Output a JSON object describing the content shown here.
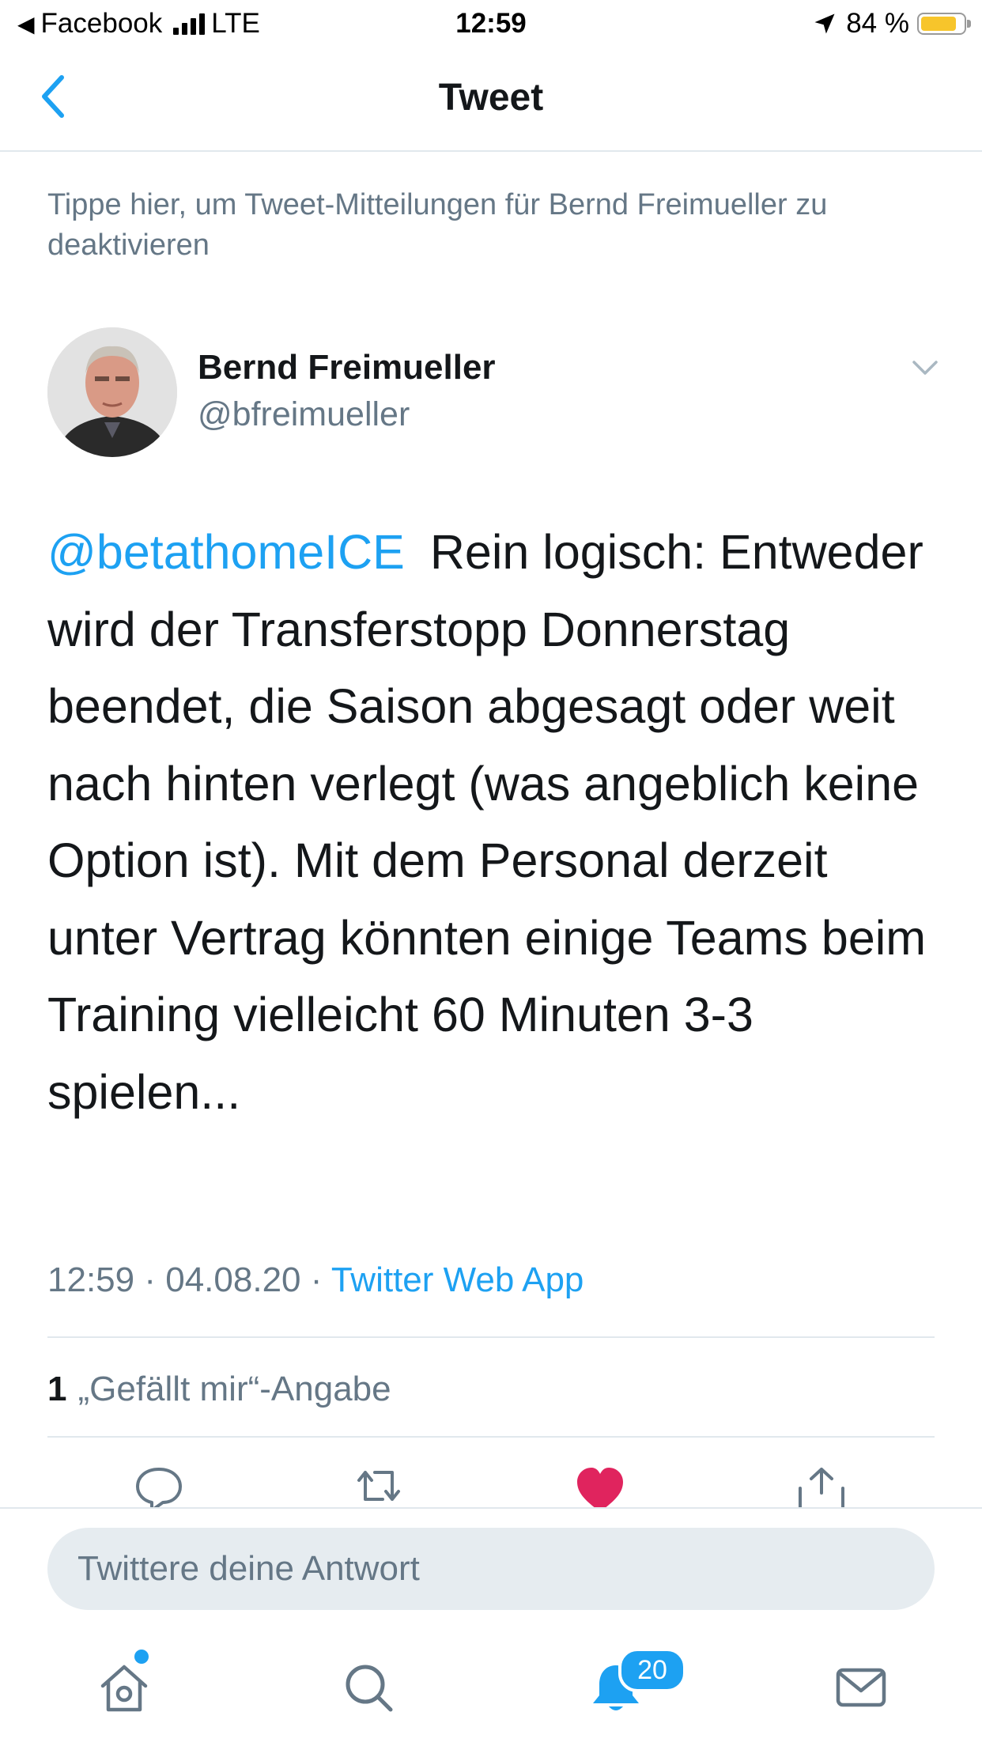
{
  "status_bar": {
    "back_app": "Facebook",
    "network": "LTE",
    "time": "12:59",
    "battery": "84 %",
    "battery_level": 0.84
  },
  "nav": {
    "title": "Tweet"
  },
  "notice": "Tippe hier, um Tweet-Mitteilungen für Bernd Freimueller zu deaktivieren",
  "author": {
    "name": "Bernd Freimueller",
    "handle": "@bfreimueller"
  },
  "tweet": {
    "mention": "@betathomeICE",
    "body": "Rein logisch: Entweder wird der Transferstopp Donnerstag beendet, die Saison abgesagt oder weit nach hinten verlegt (was angeblich keine Option ist). Mit dem Personal derzeit unter Vertrag könnten einige Teams beim Training vielleicht 60 Minuten 3-3 spielen..."
  },
  "meta": {
    "time": "12:59",
    "separator": "·",
    "date": "04.08.20",
    "via": "Twitter Web App"
  },
  "likes": {
    "count": "1",
    "label": "„Gefällt mir“-Angabe"
  },
  "reply": {
    "placeholder": "Twittere deine Antwort"
  },
  "tabbar": {
    "notifications_badge": "20"
  },
  "colors": {
    "accent": "#1da1f2",
    "like": "#e0245e",
    "secondary_text": "#657786"
  },
  "icons": [
    "back-chevron-icon",
    "reply-icon",
    "retweet-icon",
    "like-heart-icon",
    "share-icon",
    "home-icon",
    "search-icon",
    "notifications-bell-icon",
    "messages-icon",
    "chevron-down-icon"
  ]
}
